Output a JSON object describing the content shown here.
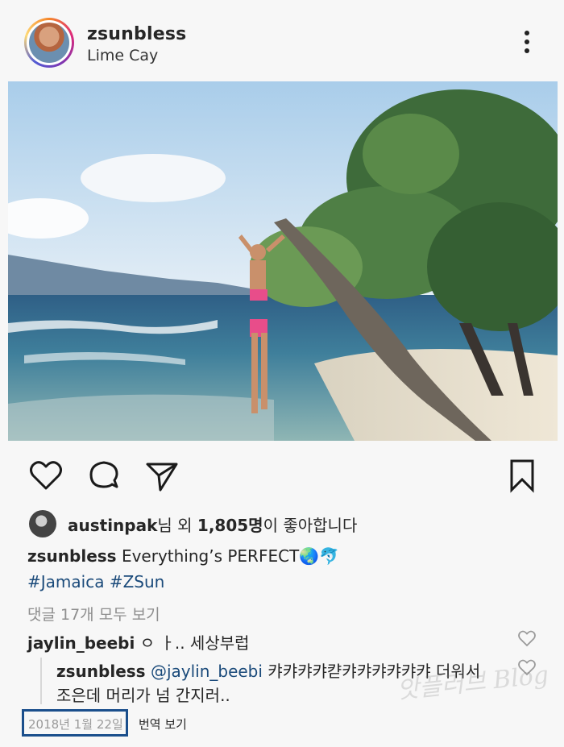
{
  "post": {
    "username": "zsunbless",
    "location": "Lime Cay",
    "more_icon": "more-vertical-icon"
  },
  "actions": {
    "like_icon": "heart-outline-icon",
    "comment_icon": "comment-bubble-icon",
    "share_icon": "send-paper-plane-icon",
    "save_icon": "bookmark-outline-icon"
  },
  "likes": {
    "liker": "austinpak",
    "text_mid": "님 외 ",
    "count": "1,805명",
    "text_end": "이 좋아합니다"
  },
  "caption": {
    "username": "zsunbless",
    "text": "Everything’s PERFECT🌏🐬",
    "hashtags": "#Jamaica #ZSun"
  },
  "comments": {
    "view_all": "댓글 17개 모두 보기",
    "first": {
      "username": "jaylin_beebi",
      "text": "ㅇ ㅏ.. 세상부럽"
    },
    "reply": {
      "username": "zsunbless",
      "mention": "@jaylin_beebi",
      "text_line1": "캬캬캬캬캳캬캬캬캬캬캬 더워서",
      "text_line2": "조은데 머리가 넘 간지러.."
    }
  },
  "meta": {
    "date": "2018년 1월 22일",
    "translate": "번역 보기"
  },
  "watermark": "앗플러브 Blog",
  "colors": {
    "hashtag": "#1a4a7a",
    "highlight_box": "#1b4f8c",
    "muted_text": "#8e8e8e"
  }
}
